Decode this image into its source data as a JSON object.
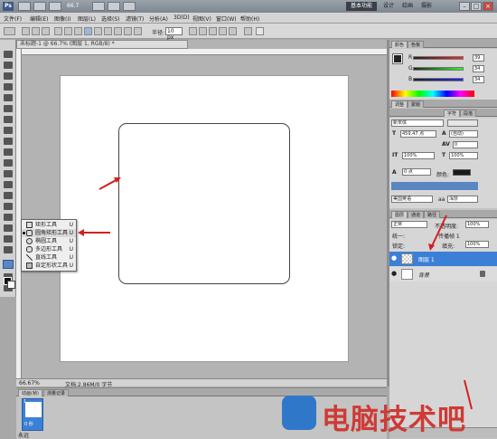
{
  "window": {
    "logo": "Ps",
    "zoom": "66.7",
    "workspaces": [
      "基本功能",
      "设计",
      "绘画",
      "摄影"
    ],
    "active_workspace": "基本功能",
    "controls": [
      "minimize-icon",
      "maximize-icon",
      "close-icon"
    ]
  },
  "menu": [
    "文件(F)",
    "编辑(E)",
    "图像(I)",
    "图层(L)",
    "选择(S)",
    "滤镜(T)",
    "分析(A)",
    "3D(D)",
    "视图(V)",
    "窗口(W)",
    "帮助(H)"
  ],
  "options": {
    "radius_label": "半径:",
    "radius_value": "10 px"
  },
  "document": {
    "tab_title": "未标题-1 @ 66.7% (图层 1, RGB/8) *",
    "zoom_readout": "66.67%",
    "doc_info": "文档:2.86M/0 字节"
  },
  "flyout": {
    "items": [
      {
        "label": "矩形工具",
        "key": "U",
        "selected": false
      },
      {
        "label": "圆角矩形工具",
        "key": "U",
        "selected": true
      },
      {
        "label": "椭圆工具",
        "key": "U",
        "selected": false
      },
      {
        "label": "多边形工具",
        "key": "U",
        "selected": false
      },
      {
        "label": "直线工具",
        "key": "U",
        "selected": false
      },
      {
        "label": "自定形状工具",
        "key": "U",
        "selected": false
      }
    ]
  },
  "color_panel": {
    "tabs": [
      "颜色",
      "色板"
    ],
    "r": "39",
    "g": "34",
    "b": "34",
    "foreground": "#222222"
  },
  "adjust_tabs": [
    "调整",
    "蒙版"
  ],
  "character_panel": {
    "tabs": [
      "字符",
      "段落"
    ],
    "font": "新宋体",
    "size": "459.47 点",
    "leading": "(自动)",
    "tracking": "0",
    "vscale": "100%",
    "hscale": "100%",
    "kern": "0 点",
    "color_label": "颜色:",
    "language": "美国英语",
    "antialias": "浑厚",
    "aa_label": "aa"
  },
  "layers_panel": {
    "tabs": [
      "图层",
      "通道",
      "路径"
    ],
    "blend_mode": "正常",
    "opacity_label": "不透明度:",
    "opacity": "100%",
    "unify_label": "统一:",
    "propagate_label": "传播帧 1",
    "lock_label": "锁定:",
    "fill_label": "填充:",
    "fill": "100%",
    "layers": [
      {
        "name": "图层 1",
        "selected": true
      },
      {
        "name": "背景",
        "selected": false,
        "locked": true
      }
    ]
  },
  "animation_panel": {
    "tabs": [
      "动画(帧)",
      "测量记录"
    ],
    "frame_number": "1",
    "frame_time": "0 秒",
    "loop": "永远"
  },
  "watermark": {
    "text": "电脑技术吧"
  },
  "accent_color": "#3c7fd6",
  "arrow_color": "#d42020"
}
